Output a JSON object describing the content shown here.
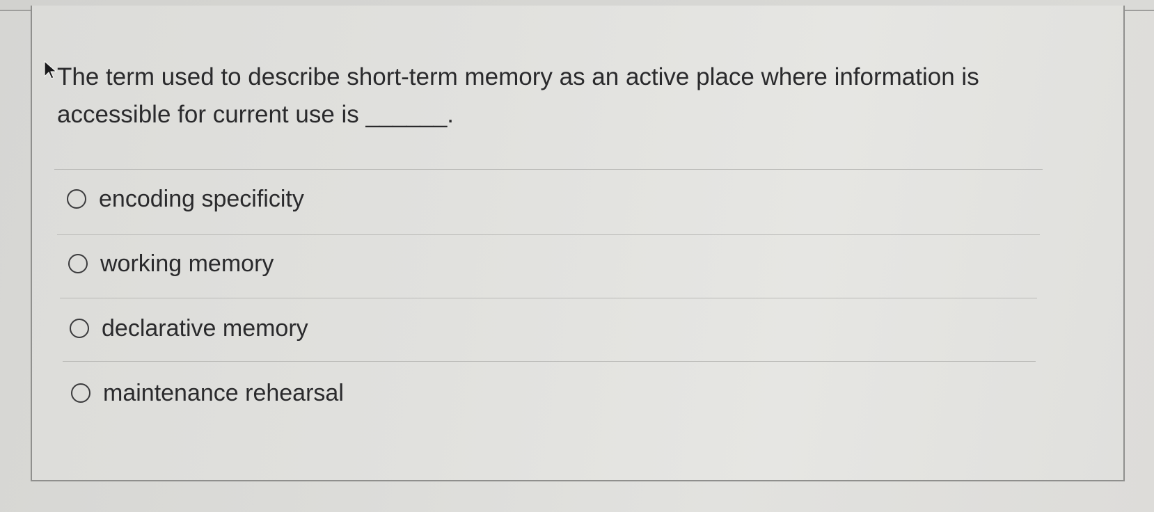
{
  "question": {
    "text": "The term used to describe short-term memory as an active place where information is accessible for current use is ______."
  },
  "options": [
    {
      "label": "encoding specificity",
      "selected": false
    },
    {
      "label": "working memory",
      "selected": false
    },
    {
      "label": "declarative memory",
      "selected": false
    },
    {
      "label": "maintenance rehearsal",
      "selected": false
    }
  ],
  "colors": {
    "text": "#2a2a2c",
    "border": "#8f8f8d",
    "divider": "#b9b9b6",
    "background": "#e0e0dd"
  },
  "icons": {
    "cursor": "mouse-pointer-icon",
    "radio": "radio-unchecked-icon"
  }
}
